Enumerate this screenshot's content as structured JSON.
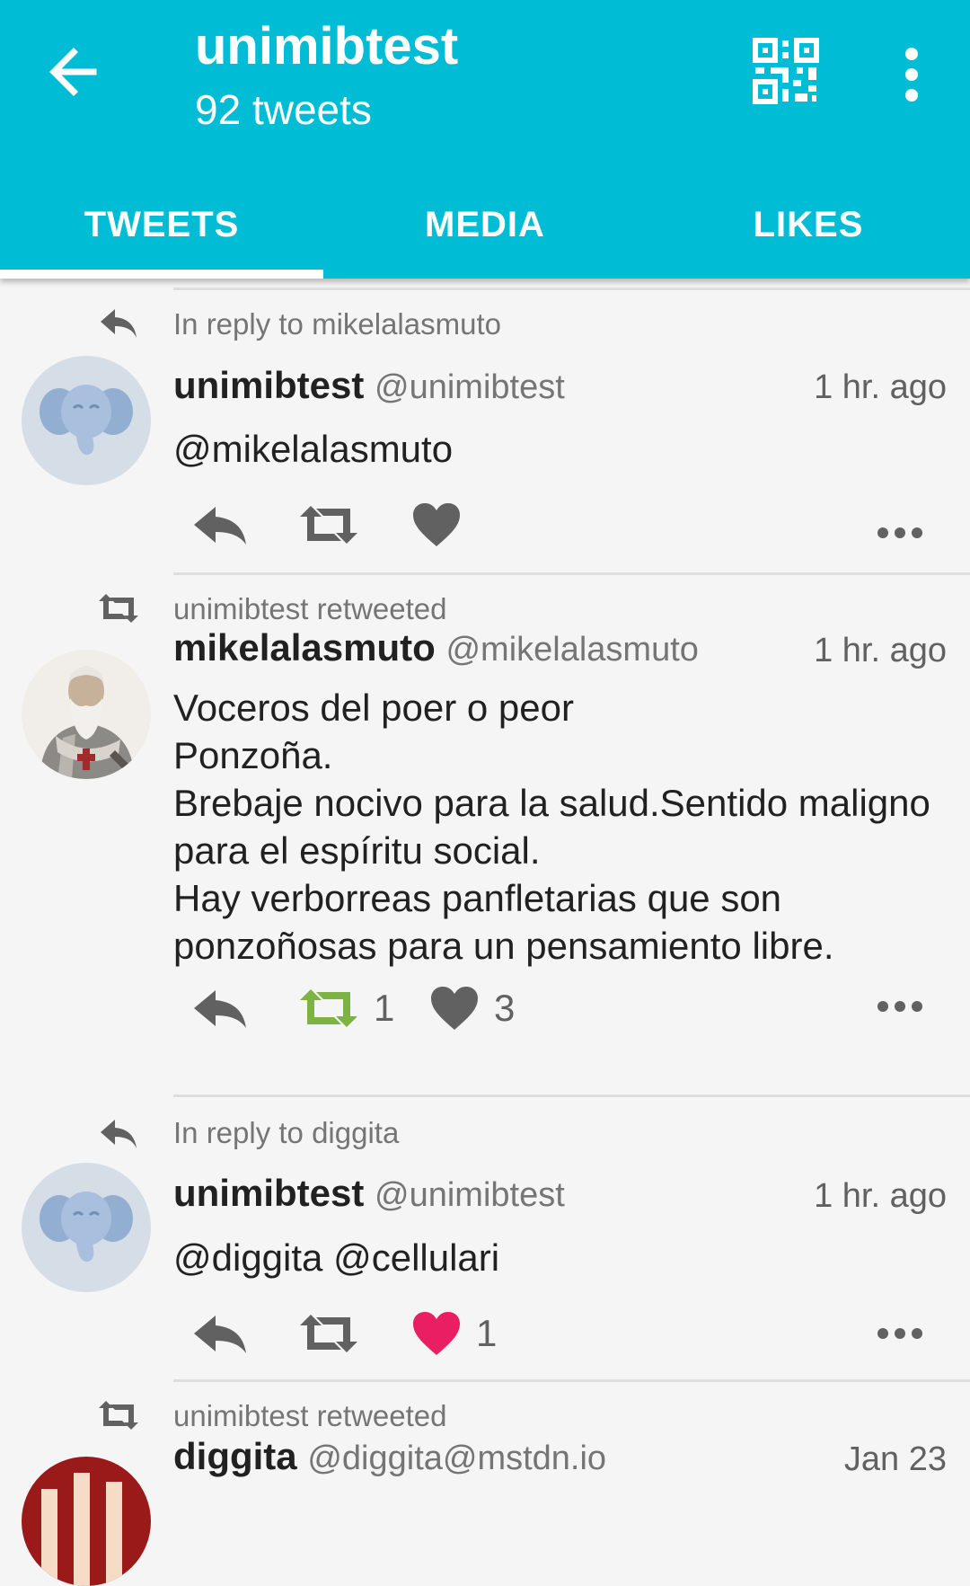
{
  "header": {
    "title": "unimibtest",
    "subtitle": "92 tweets",
    "back_icon": "arrow-left-icon",
    "qr_icon": "qr-code-icon",
    "menu_icon": "more-vertical-icon",
    "background_color": "#00bcd4"
  },
  "tabs": [
    {
      "label": "TWEETS",
      "active": true
    },
    {
      "label": "MEDIA",
      "active": false
    },
    {
      "label": "LIKES",
      "active": false
    }
  ],
  "feed": [
    {
      "context_text": "In reply to mikelalasmuto",
      "context_icon": "reply-icon",
      "display_name": "unimibtest",
      "handle": "@unimibtest",
      "time": "1 hr. ago",
      "content": "@mikelalasmuto",
      "retweet_count": "",
      "like_count": "",
      "retweeted": false,
      "liked": false
    },
    {
      "context_text": "unimibtest retweeted",
      "context_icon": "retweet-icon",
      "display_name": "mikelalasmuto",
      "handle": "@mikelalasmuto",
      "time": "1 hr. ago",
      "content": "Voceros del poer o peor\nPonzoña.\nBrebaje nocivo para la salud.Sentido maligno para el espíritu social.\nHay verborreas panfletarias que son ponzoñosas para un pensamiento libre.",
      "retweet_count": "1",
      "like_count": "3",
      "retweeted": true,
      "liked": false
    },
    {
      "context_text": "In reply to diggita",
      "context_icon": "reply-icon",
      "display_name": "unimibtest",
      "handle": "@unimibtest",
      "time": "1 hr. ago",
      "content": "@diggita @cellulari",
      "retweet_count": "",
      "like_count": "1",
      "retweeted": false,
      "liked": true
    },
    {
      "context_text": "unimibtest retweeted",
      "context_icon": "retweet-icon",
      "display_name": "diggita",
      "handle": "@diggita@mstdn.io",
      "time": "Jan 23"
    }
  ],
  "colors": {
    "retweet_active": "#7cb342",
    "like_active": "#e91e63",
    "icon_default": "#616161"
  }
}
